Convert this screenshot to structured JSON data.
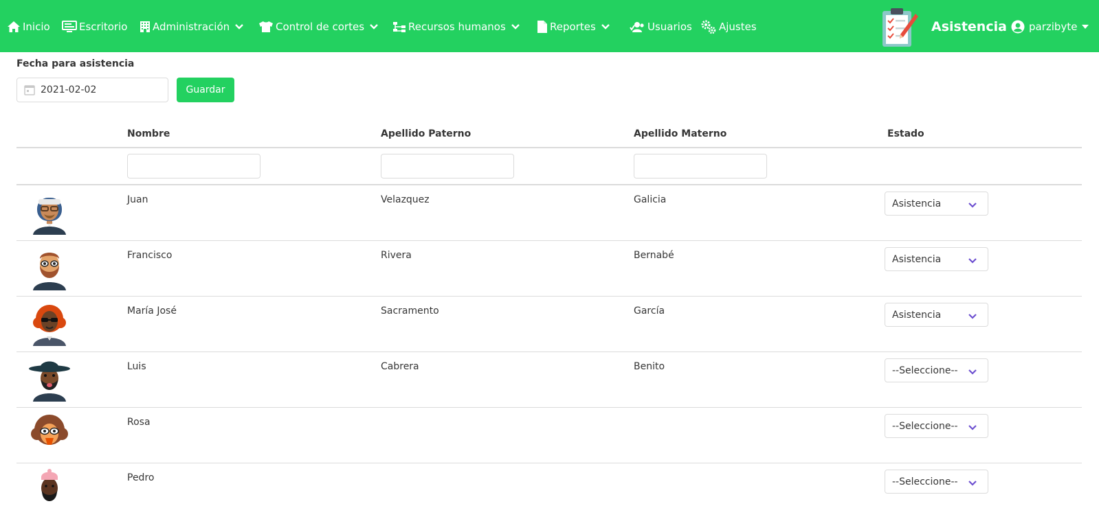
{
  "nav": {
    "items": [
      {
        "label": "Inicio",
        "icon": "home-icon",
        "dropdown": false
      },
      {
        "label": "Escritorio",
        "icon": "desktop-icon",
        "dropdown": false
      },
      {
        "label": "Administración",
        "icon": "building-icon",
        "dropdown": true
      },
      {
        "label": "Control de cortes",
        "icon": "shirt-icon",
        "dropdown": true
      },
      {
        "label": "Recursos humanos",
        "icon": "sitemap-icon",
        "dropdown": true
      },
      {
        "label": "Reportes",
        "icon": "file-icon",
        "dropdown": true
      },
      {
        "label": "Usuarios",
        "icon": "users-icon",
        "dropdown": false
      },
      {
        "label": "Ajustes",
        "icon": "cogs-icon",
        "dropdown": false
      }
    ],
    "brand_title": "Asistencia",
    "user": "parzibyte",
    "color": "#23d160"
  },
  "form": {
    "date_label": "Fecha para asistencia",
    "date_value": "2021-02-02",
    "save_label": "Guardar"
  },
  "table": {
    "headers": [
      "Nombre",
      "Apellido Paterno",
      "Apellido Materno",
      "Estado"
    ],
    "rows": [
      {
        "nombre": "Juan",
        "paterno": "Velazquez",
        "materno": "Galicia",
        "estado": "Asistencia",
        "avatar": "avatar-headband-glasses"
      },
      {
        "nombre": "Francisco",
        "paterno": "Rivera",
        "materno": "Bernabé",
        "estado": "Asistencia",
        "avatar": "avatar-bearded-sunglasses"
      },
      {
        "nombre": "María José",
        "paterno": "Sacramento",
        "materno": "García",
        "estado": "Asistencia",
        "avatar": "avatar-red-hair-sunglasses"
      },
      {
        "nombre": "Luis",
        "paterno": "Cabrera",
        "materno": "Benito",
        "estado": "--Seleccione--",
        "avatar": "avatar-hat-beard"
      },
      {
        "nombre": "Rosa",
        "paterno": "",
        "materno": "",
        "estado": "--Seleccione--",
        "avatar": "avatar-curly-hair-sunglasses"
      },
      {
        "nombre": "Pedro",
        "paterno": "",
        "materno": "",
        "estado": "--Seleccione--",
        "avatar": "avatar-beanie-beard"
      }
    ]
  }
}
